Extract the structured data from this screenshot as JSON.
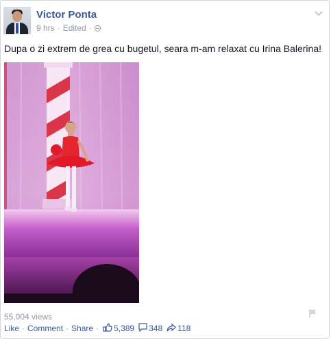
{
  "post": {
    "author_name": "Victor Ponta",
    "timestamp": "9 hrs",
    "edited_label": "Edited",
    "meta_separator": "·",
    "message": "Dupa o zi extrem de grea cu bugetul, seara m-am relaxat cu Irina Balerina!",
    "privacy_icon": "globe-icon",
    "menu_icon": "chevron-down-icon"
  },
  "video": {
    "views": "55,004 views"
  },
  "actions": {
    "like_label": "Like",
    "comment_label": "Comment",
    "share_label": "Share",
    "separator": "·",
    "likes_count": "5,389",
    "comments_count": "348",
    "shares_count": "118"
  },
  "colors": {
    "link_blue": "#3b5998",
    "meta_gray": "#9197a3",
    "text": "#141823",
    "border": "#d3d6db"
  }
}
